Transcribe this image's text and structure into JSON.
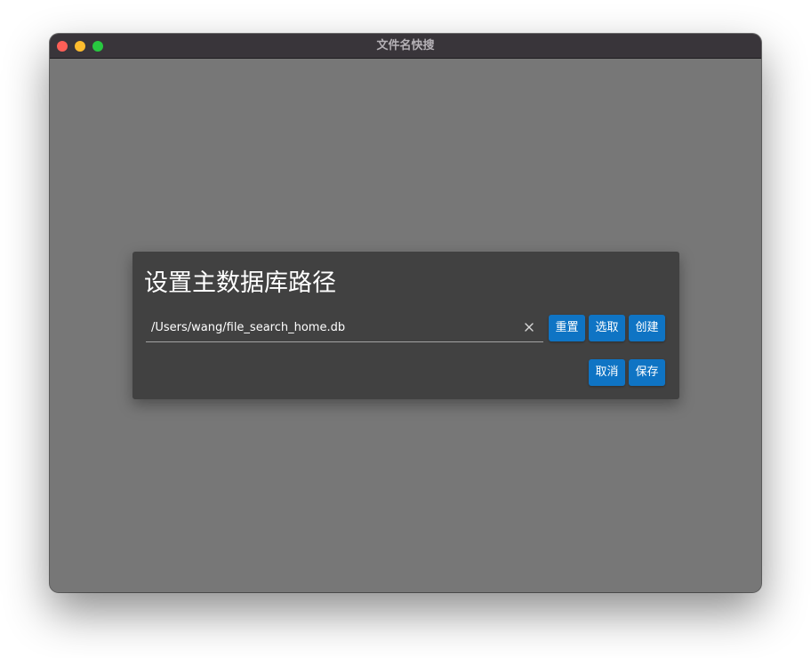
{
  "window": {
    "title": "文件名快搜"
  },
  "dialog": {
    "title": "设置主数据库路径",
    "path_value": "/Users/wang/file_search_home.db",
    "reset_label": "重置",
    "pick_label": "选取",
    "create_label": "创建",
    "cancel_label": "取消",
    "save_label": "保存"
  },
  "icons": {
    "clear": "close-icon"
  },
  "colors": {
    "titlebar": "#39353a",
    "content_bg": "#777777",
    "dialog_bg": "#414141",
    "button": "#0f74c4",
    "traffic_close": "#fe5f57",
    "traffic_minimize": "#febc2e",
    "traffic_zoom": "#28c840"
  }
}
